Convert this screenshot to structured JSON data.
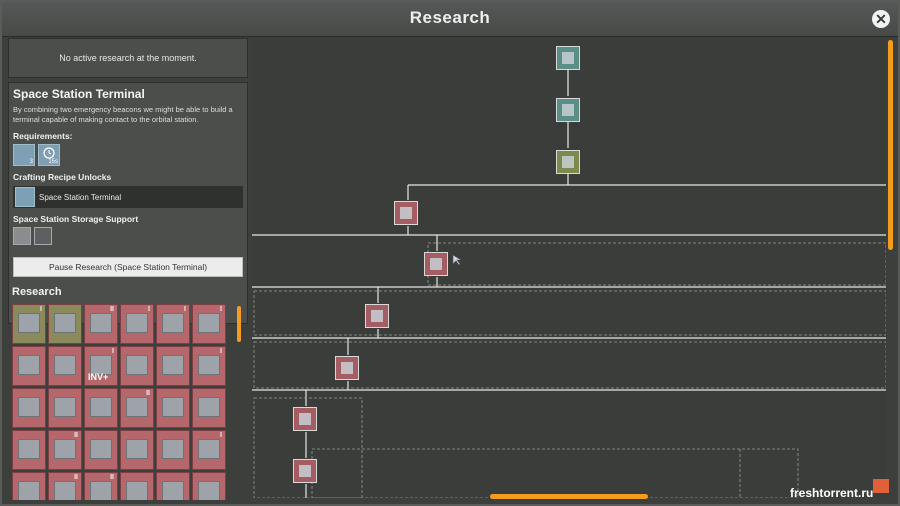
{
  "window": {
    "title": "Research",
    "close_icon": "close-icon"
  },
  "status": {
    "no_active": "No active research at the moment."
  },
  "detail": {
    "name": "Space Station Terminal",
    "description": "By combining two emergency beacons we might be able to build a terminal capable of making contact to the orbital station.",
    "requirements_label": "Requirements:",
    "requirements": [
      {
        "icon": "beacon-icon",
        "badge": "3"
      },
      {
        "icon": "clock-icon",
        "badge": "15s"
      }
    ],
    "crafting_label": "Crafting Recipe Unlocks",
    "recipe": {
      "icon": "terminal-icon",
      "label": "Space Station Terminal"
    },
    "storage_label": "Space Station Storage Support",
    "storage_icons": [
      "plate-icon",
      "sphere-icon"
    ],
    "pause_button": "Pause Research (Space Station Terminal)"
  },
  "research_header": "Research",
  "grid": [
    {
      "color": "olive",
      "tier": "I"
    },
    {
      "color": "olive",
      "tier": ""
    },
    {
      "color": "red",
      "tier": "II"
    },
    {
      "color": "red",
      "tier": "I"
    },
    {
      "color": "red",
      "tier": "I"
    },
    {
      "color": "red",
      "tier": "I"
    },
    {
      "color": "red",
      "tier": ""
    },
    {
      "color": "red",
      "tier": ""
    },
    {
      "color": "red",
      "tier": "I",
      "text": "INV+"
    },
    {
      "color": "red",
      "tier": ""
    },
    {
      "color": "red",
      "tier": ""
    },
    {
      "color": "red",
      "tier": "I"
    },
    {
      "color": "red",
      "tier": ""
    },
    {
      "color": "red",
      "tier": ""
    },
    {
      "color": "red",
      "tier": ""
    },
    {
      "color": "red",
      "tier": "II"
    },
    {
      "color": "red",
      "tier": ""
    },
    {
      "color": "red",
      "tier": ""
    },
    {
      "color": "red",
      "tier": ""
    },
    {
      "color": "red",
      "tier": "II"
    },
    {
      "color": "red",
      "tier": ""
    },
    {
      "color": "red",
      "tier": ""
    },
    {
      "color": "red",
      "tier": ""
    },
    {
      "color": "red",
      "tier": "I"
    },
    {
      "color": "red",
      "tier": ""
    },
    {
      "color": "red",
      "tier": "II"
    },
    {
      "color": "red",
      "tier": "II"
    },
    {
      "color": "red",
      "tier": ""
    },
    {
      "color": "red",
      "tier": ""
    },
    {
      "color": "red",
      "tier": ""
    }
  ],
  "tree_nodes": [
    {
      "color": "teal",
      "icon": "beacon-icon"
    },
    {
      "color": "teal",
      "icon": "terminal-icon"
    },
    {
      "color": "green",
      "icon": "crate-icon"
    },
    {
      "color": "red",
      "icon": "upgrade-icon"
    },
    {
      "color": "red",
      "icon": "machine-icon"
    },
    {
      "color": "red",
      "icon": "ring-icon"
    },
    {
      "color": "red",
      "icon": "rack-icon"
    },
    {
      "color": "red",
      "icon": "drill-icon"
    },
    {
      "color": "red",
      "icon": "press-icon"
    }
  ],
  "watermark": "freshtorrent.ru"
}
